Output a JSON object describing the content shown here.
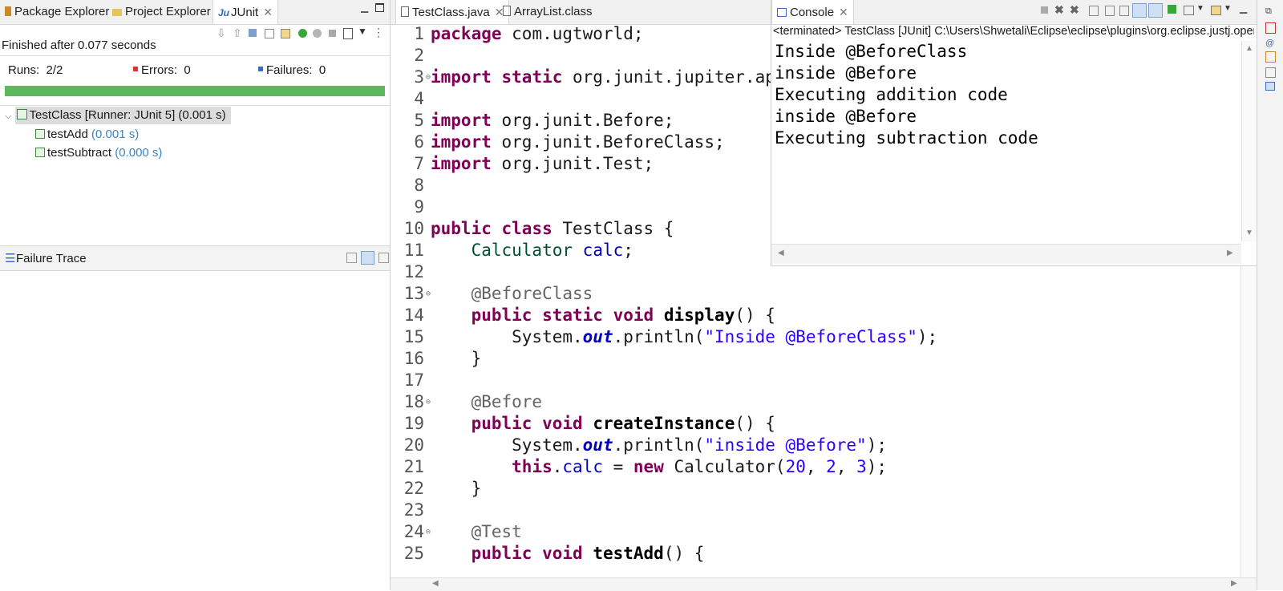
{
  "left_panel": {
    "tabs": [
      {
        "label": "Package Explorer"
      },
      {
        "label": "Project Explorer"
      },
      {
        "label": "JUnit"
      }
    ],
    "status_text": "Finished after 0.077 seconds",
    "runs_label": "Runs:",
    "runs_value": "2/2",
    "errors_label": "Errors:",
    "errors_value": "0",
    "failures_label": "Failures:",
    "failures_value": "0",
    "progress": 1.0,
    "progress_color": "#5cb85c",
    "tree": {
      "root": "TestClass [Runner: JUnit 5] (0.001 s)",
      "children": [
        {
          "name": "testAdd",
          "time": "(0.001 s)"
        },
        {
          "name": "testSubtract",
          "time": "(0.000 s)"
        }
      ]
    },
    "failure_trace_title": "Failure Trace"
  },
  "editor": {
    "tabs": [
      {
        "label": "TestClass.java"
      },
      {
        "label": "ArrayList.class"
      }
    ]
  },
  "console": {
    "tab_label": "Console",
    "terminated_text": "<terminated> TestClass [JUnit] C:\\Users\\Shwetali\\Eclipse\\eclipse\\plugins\\org.eclipse.justj.openj",
    "lines": [
      "Inside @BeforeClass",
      "inside @Before",
      "Executing addition code",
      "inside @Before",
      "Executing subtraction code"
    ]
  }
}
